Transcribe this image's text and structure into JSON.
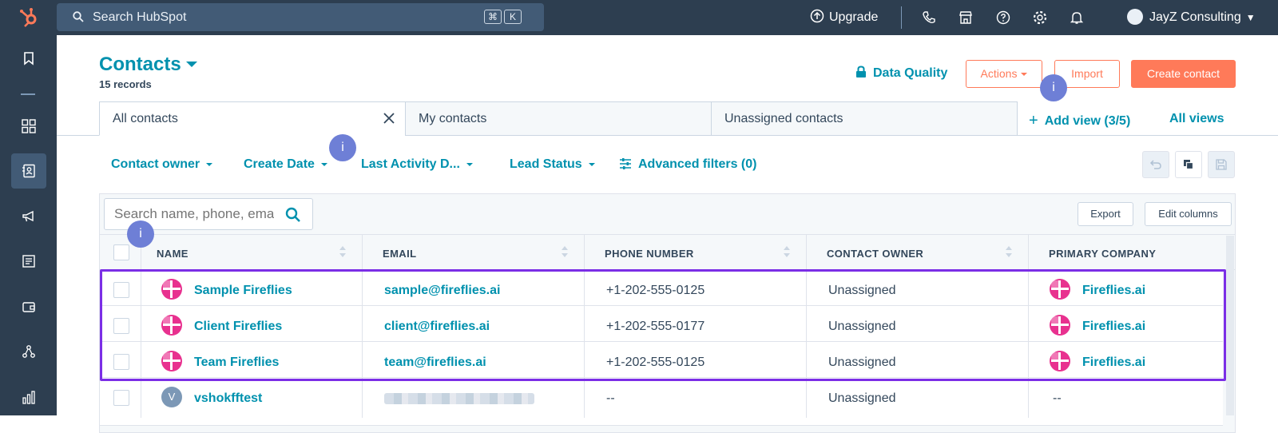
{
  "topbar": {
    "search_placeholder": "Search HubSpot",
    "kbd": [
      "⌘",
      "K"
    ],
    "upgrade_label": "Upgrade",
    "account_name": "JayZ Consulting"
  },
  "page": {
    "title": "Contacts",
    "record_count": "15 records",
    "data_quality_label": "Data Quality",
    "actions_label": "Actions",
    "import_label": "Import",
    "create_label": "Create contact"
  },
  "views": {
    "tabs": [
      {
        "label": "All contacts"
      },
      {
        "label": "My contacts"
      },
      {
        "label": "Unassigned contacts"
      }
    ],
    "add_view_label": "Add view (3/5)",
    "all_views_label": "All views"
  },
  "filters": {
    "items": [
      "Contact owner",
      "Create Date",
      "Last Activity D...",
      "Lead Status"
    ],
    "advanced_label": "Advanced filters (0)"
  },
  "table": {
    "search_placeholder": "Search name, phone, email",
    "export_label": "Export",
    "edit_columns_label": "Edit columns",
    "columns": [
      "NAME",
      "EMAIL",
      "PHONE NUMBER",
      "CONTACT OWNER",
      "PRIMARY COMPANY"
    ],
    "rows": [
      {
        "name": "Sample Fireflies",
        "email": "sample@fireflies.ai",
        "phone": "+1-202-555-0125",
        "owner": "Unassigned",
        "company": "Fireflies.ai",
        "avatar": "fireflies-logo-icon"
      },
      {
        "name": "Client Fireflies",
        "email": "client@fireflies.ai",
        "phone": "+1-202-555-0177",
        "owner": "Unassigned",
        "company": "Fireflies.ai",
        "avatar": "fireflies-logo-icon"
      },
      {
        "name": "Team Fireflies",
        "email": "team@fireflies.ai",
        "phone": "+1-202-555-0125",
        "owner": "Unassigned",
        "company": "Fireflies.ai",
        "avatar": "fireflies-logo-icon"
      },
      {
        "name": "vshokfftest",
        "email": "",
        "phone": "--",
        "owner": "Unassigned",
        "company": "--",
        "avatar_letter": "V"
      }
    ]
  },
  "markers": [
    "i",
    "i",
    "i"
  ],
  "colors": {
    "nav": "#2d3e50",
    "accent": "#0091ae",
    "cta": "#ff7a59",
    "highlight": "#7b2ee6",
    "marker": "#6e7fd6"
  }
}
